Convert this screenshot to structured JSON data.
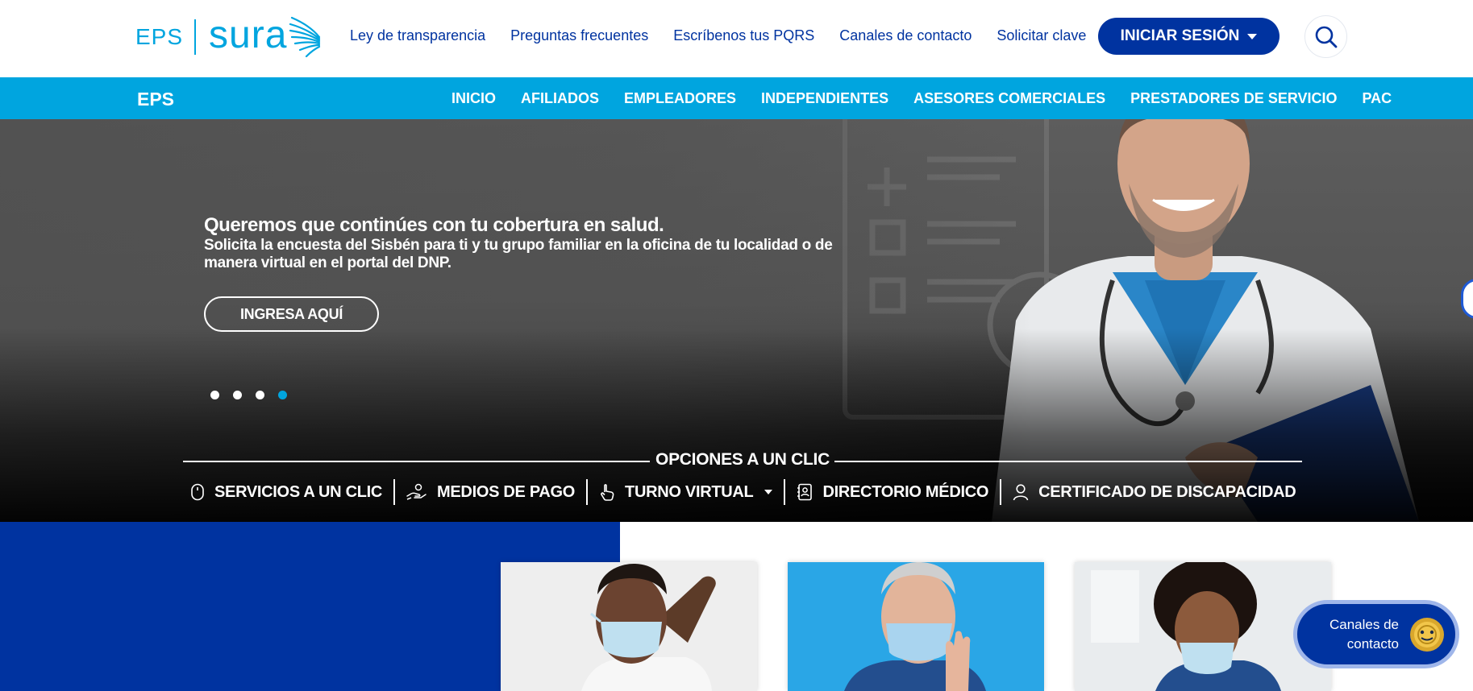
{
  "header": {
    "logo_left": "EPS",
    "logo_right": "sura",
    "links": [
      "Ley de transparencia",
      "Preguntas frecuentes",
      "Escríbenos tus PQRS",
      "Canales de contacto",
      "Solicitar clave"
    ],
    "login_label": "INICIAR SESIÓN",
    "search_icon": "search-icon"
  },
  "nav": {
    "brand": "EPS",
    "items": [
      "INICIO",
      "AFILIADOS",
      "EMPLEADORES",
      "INDEPENDIENTES",
      "ASESORES COMERCIALES",
      "PRESTADORES DE SERVICIO",
      "PAC"
    ]
  },
  "hero": {
    "title": "Queremos que continúes con tu cobertura en salud.",
    "text": "Solicita la encuesta del Sisbén para ti y tu grupo familiar en la oficina de tu localidad o de manera virtual en el portal del DNP.",
    "cta_label": "INGRESA AQUÍ",
    "slides_total": 4,
    "active_slide": 4
  },
  "options": {
    "title": "OPCIONES A UN CLIC",
    "items": [
      {
        "label": "SERVICIOS A UN CLIC",
        "icon": "mouse-icon"
      },
      {
        "label": "MEDIOS DE PAGO",
        "icon": "hand-coin-icon"
      },
      {
        "label": "TURNO VIRTUAL",
        "icon": "pointer-hand-icon"
      },
      {
        "label": "DIRECTORIO MÉDICO",
        "icon": "address-book-icon"
      },
      {
        "label": "CERTIFICADO DE DISCAPACIDAD",
        "icon": "user-icon"
      }
    ]
  },
  "floating_button": {
    "line1": "Canales de",
    "line2": "contacto",
    "icon": "coins-icon"
  },
  "colors": {
    "primary": "#0033a0",
    "accent": "#00a5df",
    "white": "#ffffff"
  }
}
